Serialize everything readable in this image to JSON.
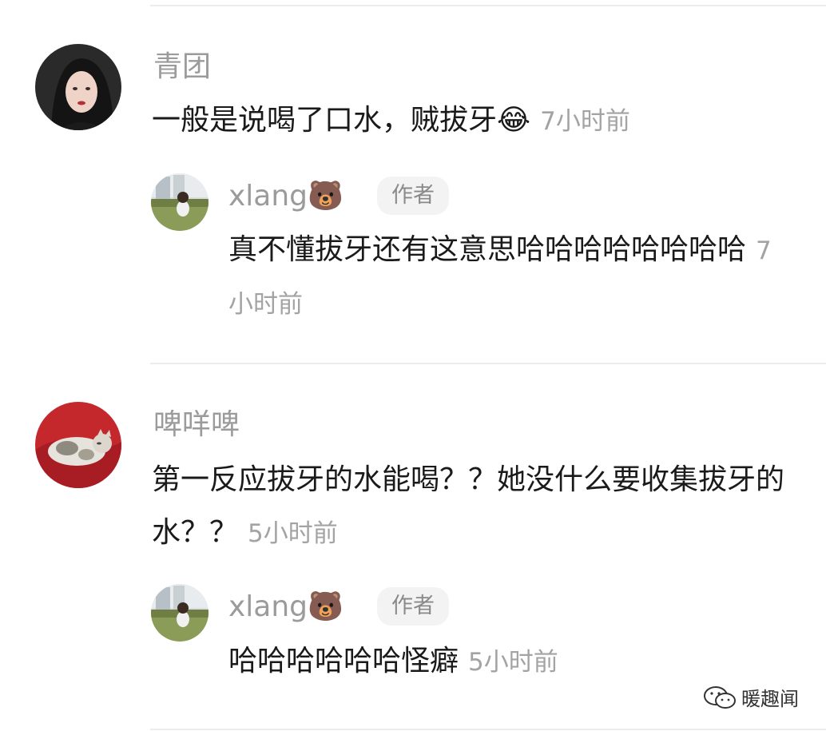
{
  "comments": [
    {
      "username": "青团",
      "text": "一般是说喝了口水，贼拔牙",
      "emoji": "😂",
      "time": "7小时前",
      "reply": {
        "username": "xlang",
        "username_emoji": "🐻",
        "badge": "作者",
        "text": "真不懂拔牙还有这意思哈哈哈哈哈哈哈哈",
        "time": "7小时前"
      }
    },
    {
      "username": "啤咩啤",
      "text": "第一反应拔牙的水能喝？？她没什么要收集拔牙的水？？",
      "time": "5小时前",
      "reply": {
        "username": "xlang",
        "username_emoji": "🐻",
        "badge": "作者",
        "text": "哈哈哈哈哈哈怪癖",
        "time": "5小时前"
      }
    }
  ],
  "watermark": {
    "text": "暖趣闻",
    "icon": "wechat-icon"
  },
  "colors": {
    "name": "#9b9b9b",
    "time": "#a3a3a3",
    "text": "#1a1a1a",
    "badge_bg": "#f3f3f3"
  }
}
